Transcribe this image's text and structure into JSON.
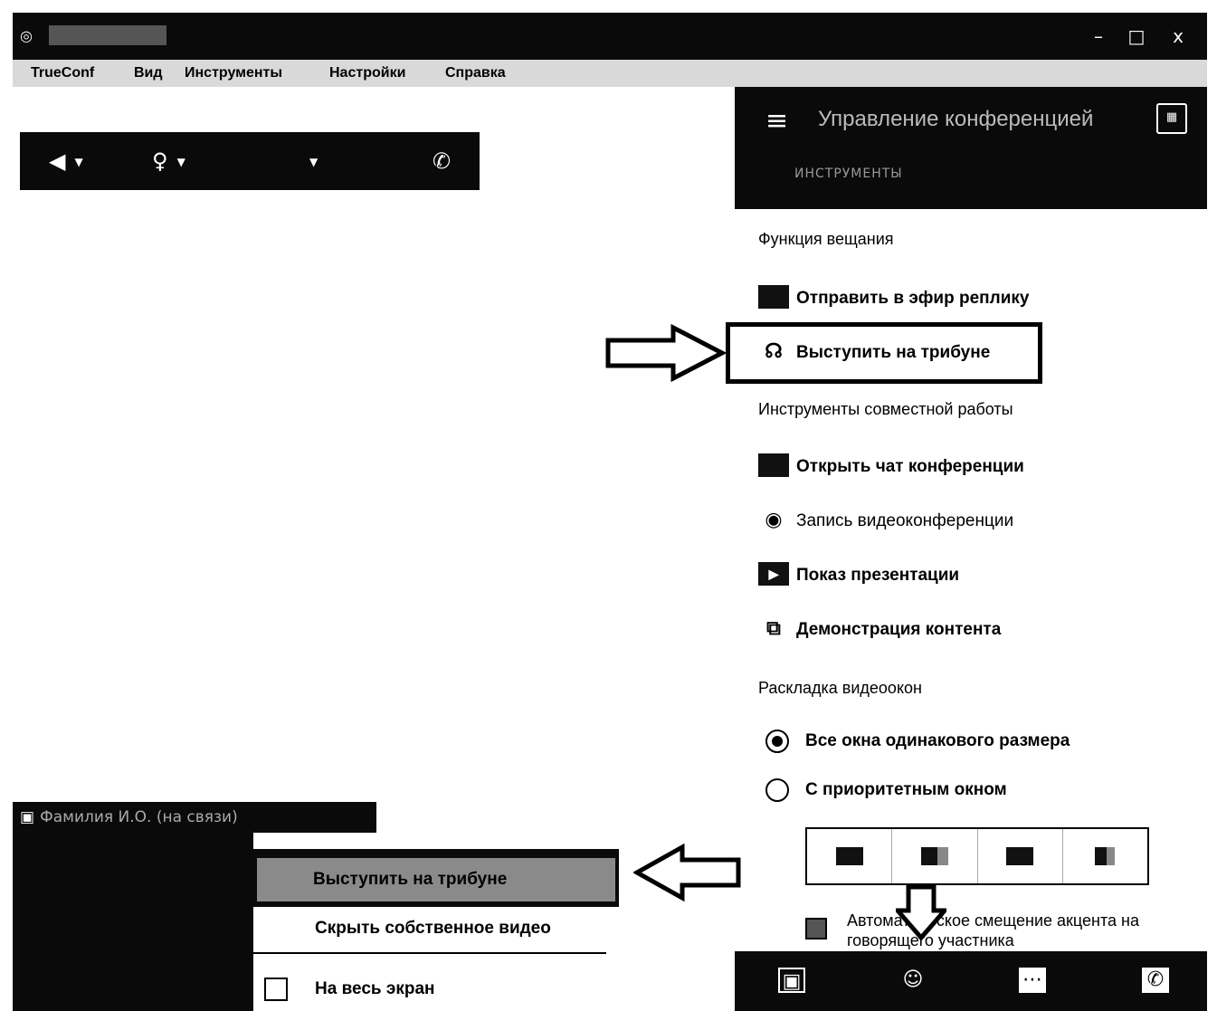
{
  "titlebar": {
    "minimize": "–",
    "maximize": "□",
    "close": "x"
  },
  "menu": [
    "TrueConf",
    "Вид",
    "Инструменты",
    "Настройки",
    "Справка"
  ],
  "panel": {
    "title": "Управление конференцией",
    "subtab": "ИНСТРУМЕНТЫ",
    "sections": {
      "broadcast": "Функция вещания",
      "collab": "Инструменты совместной работы",
      "layout": "Раскладка видеоокон"
    },
    "items": {
      "send_reply": "Отправить в эфир реплику",
      "tribune": "Выступить на трибуне",
      "chat": "Открыть чат конференции",
      "record": "Запись видеоконференции",
      "presentation": "Показ презентации",
      "content": "Демонстрация контента"
    },
    "radios": {
      "equal": "Все окна одинакового размера",
      "priority": "С приоритетным окном"
    },
    "layout_selected": "equal",
    "auto_focus": "Автоматическое смещение акцента на говорящего участника"
  },
  "self_view": {
    "label": "Фамилия И.О. (на связи)"
  },
  "context_menu": {
    "tribune": "Выступить на трибуне",
    "hide_self": "Скрыть собственное видео",
    "fullscreen": "На весь экран"
  },
  "icons": {
    "app": "camera-icon",
    "speaker": "speaker-icon",
    "microphone": "microphone-icon",
    "camera_dropdown": "chevron-down-icon",
    "hangup": "phone-icon",
    "hamburger": "menu-icon",
    "calendar": "calendar-icon",
    "footer": [
      "contacts-icon",
      "participants-icon",
      "chat-icon",
      "hangup-icon"
    ]
  },
  "colors": {
    "dark": "#0a0a0a",
    "menubar": "#d9d9d9",
    "highlight": "#8a8a8a"
  }
}
